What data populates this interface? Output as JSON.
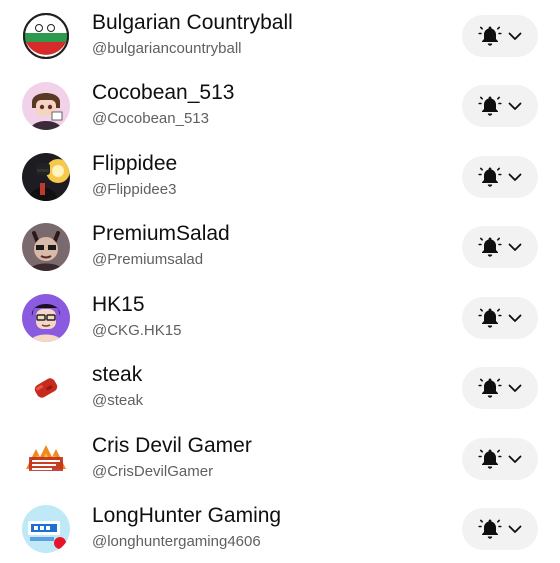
{
  "subscriptions": [
    {
      "name": "Bulgarian Countryball",
      "handle": "@bulgariancountryball"
    },
    {
      "name": "Cocobean_513",
      "handle": "@Cocobean_513"
    },
    {
      "name": "Flippidee",
      "handle": "@Flippidee3"
    },
    {
      "name": "PremiumSalad",
      "handle": "@Premiumsalad"
    },
    {
      "name": "HK15",
      "handle": "@CKG.HK15"
    },
    {
      "name": "steak",
      "handle": "@steak"
    },
    {
      "name": "Cris Devil Gamer",
      "handle": "@CrisDevilGamer"
    },
    {
      "name": "LongHunter Gaming",
      "handle": "@longhuntergaming4606"
    }
  ],
  "icons": {
    "notification": "bell-icon",
    "dropdown": "chevron-down-icon"
  },
  "colors": {
    "button_bg": "#f2f2f2",
    "name_text": "#0f0f0f",
    "handle_text": "#606060"
  }
}
